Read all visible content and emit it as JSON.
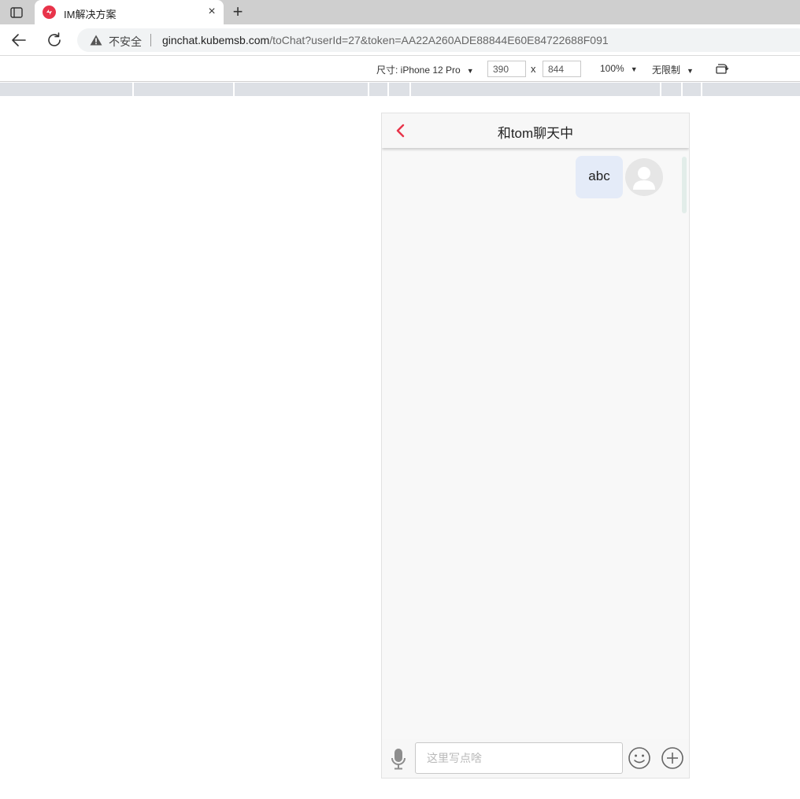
{
  "browser": {
    "tab": {
      "title": "IM解决方案",
      "close_glyph": "×",
      "favicon": "app-logo-icon"
    },
    "new_tab_glyph": "+",
    "address": {
      "security_label": "不安全",
      "url_host": "ginchat.kubemsb.com",
      "url_path": "/toChat?userId=27&token=AA22A260ADE88844E60E84722688F091"
    }
  },
  "devtools": {
    "device_label": "尺寸: iPhone 12 Pro",
    "width_value": "390",
    "height_value": "844",
    "times": "x",
    "zoom_label": "100%",
    "throttle_label": "无限制",
    "caret": "▼"
  },
  "chat": {
    "title": "和tom聊天中",
    "messages": [
      {
        "text": "abc",
        "side": "right"
      }
    ],
    "input_placeholder": "这里写点啥"
  },
  "colors": {
    "accent": "#e8344a",
    "bubble": "#e4ebf8",
    "background": "#f8f8f8"
  }
}
